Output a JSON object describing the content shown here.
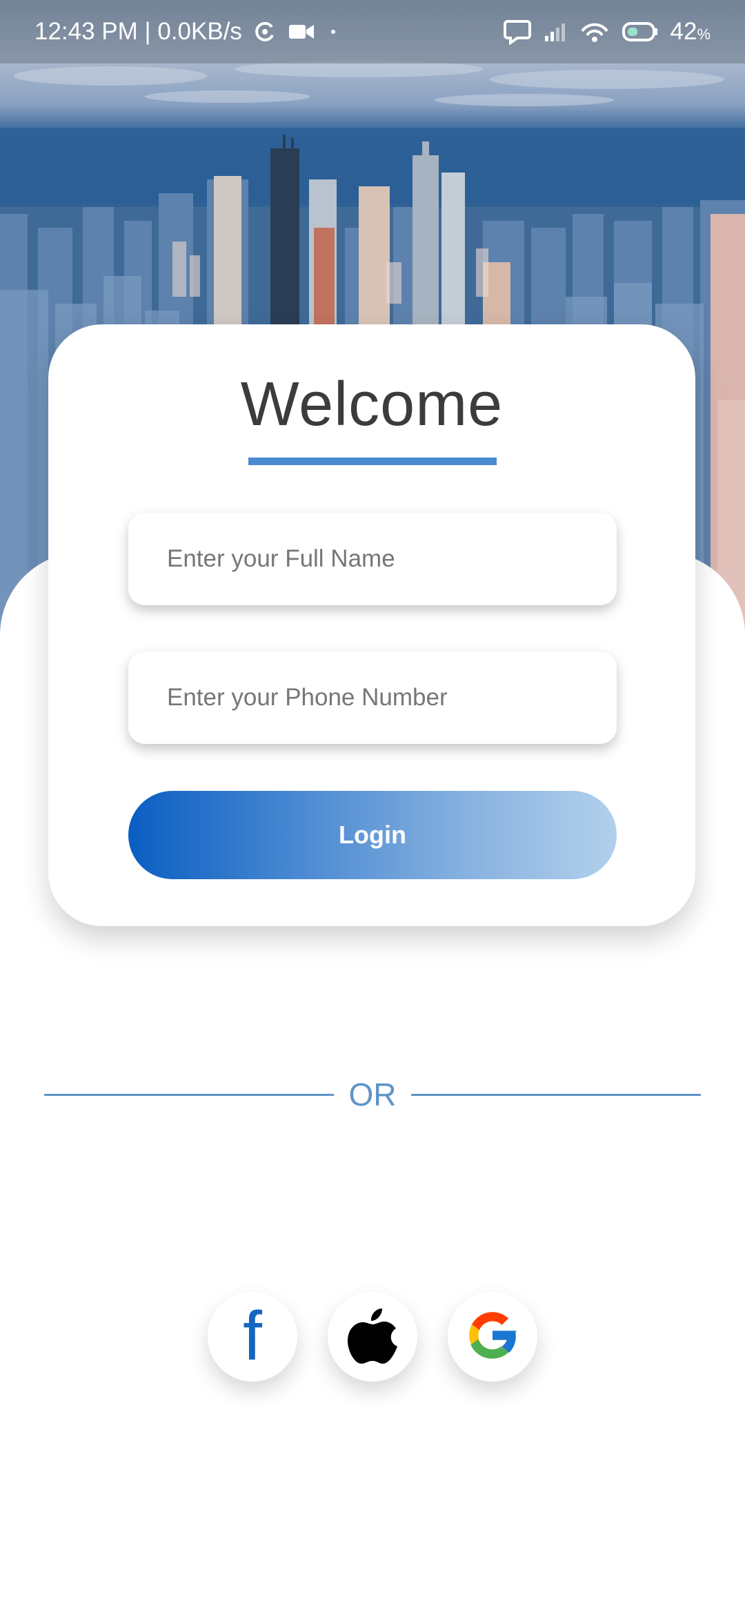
{
  "status_bar": {
    "time_speed": "12:43 PM | 0.0KB/s",
    "battery_value": "42",
    "battery_unit": "%",
    "icons": [
      "sync-icon",
      "video-camera-icon",
      "dot-icon",
      "chat-bubble-icon",
      "signal-icon",
      "hotspot-icon",
      "battery-icon"
    ]
  },
  "card": {
    "title": "Welcome",
    "name_placeholder": "Enter your Full Name",
    "phone_placeholder": "Enter your Phone Number",
    "login_label": "Login"
  },
  "divider": {
    "label": "OR"
  },
  "social": {
    "facebook_glyph": "f",
    "icons": [
      "facebook-icon",
      "apple-icon",
      "google-icon"
    ]
  },
  "colors": {
    "accent": "#4a8ad0",
    "divider": "#5f93c8",
    "button_start": "#0a5ec2",
    "button_end": "#b2d0ec",
    "title_text": "#3c3c3c"
  }
}
